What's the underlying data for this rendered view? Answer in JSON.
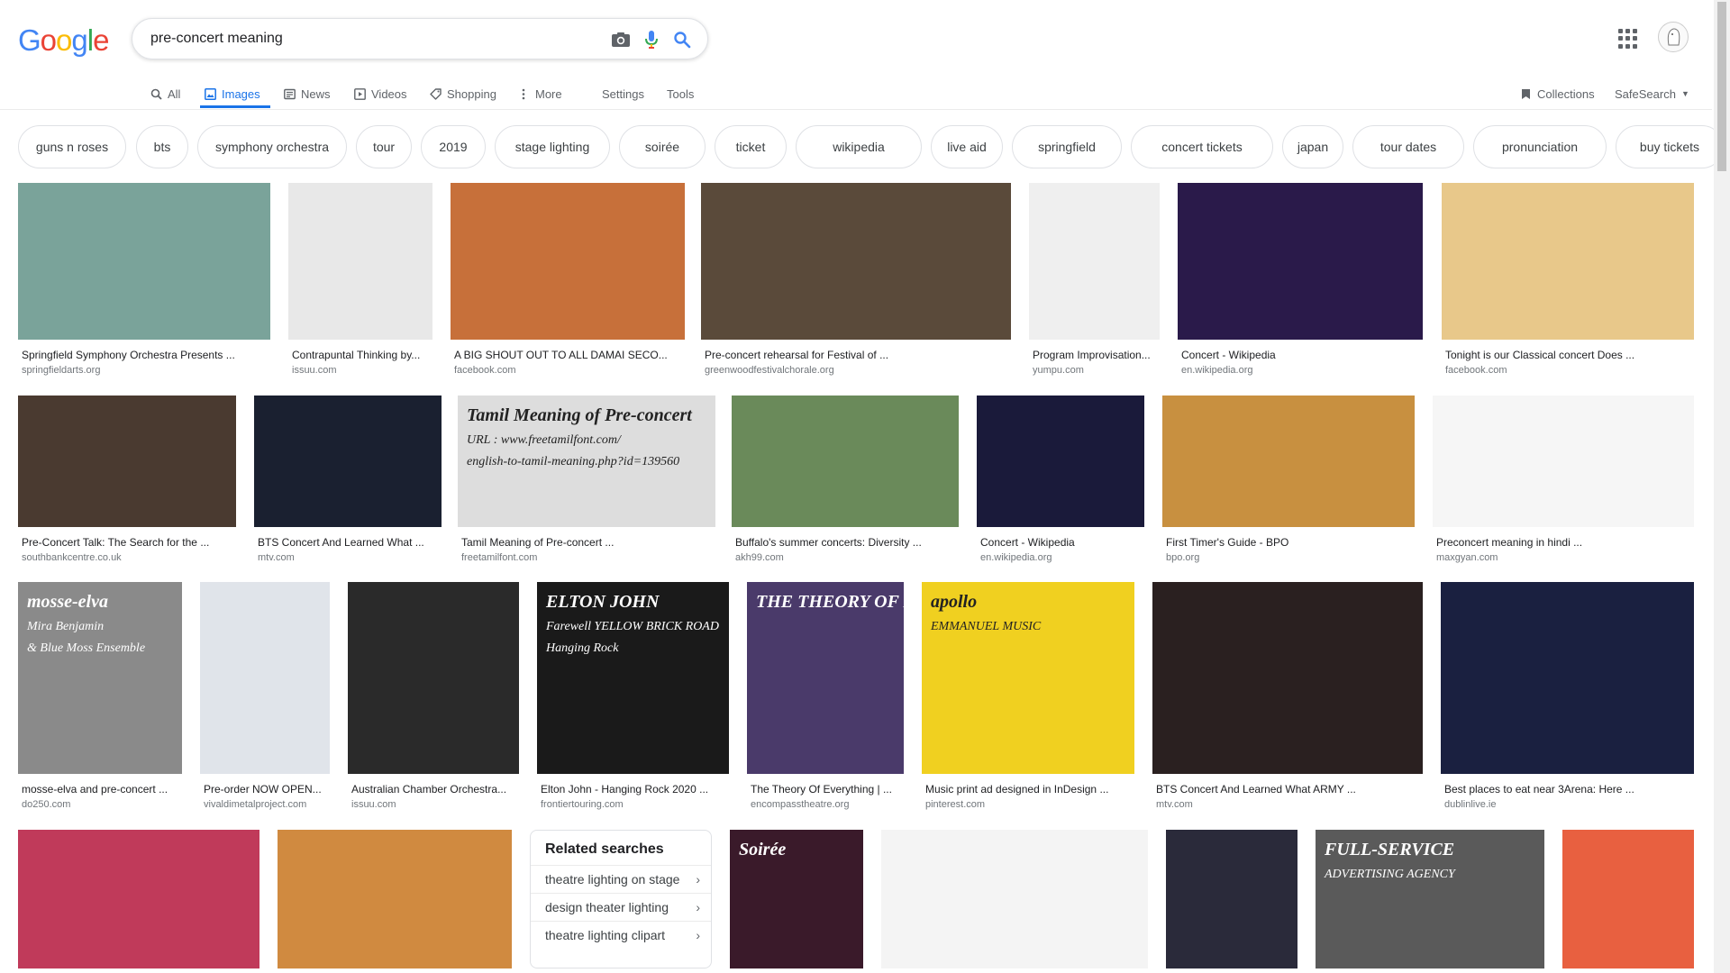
{
  "logo": {
    "letters": [
      "G",
      "o",
      "o",
      "g",
      "l",
      "e"
    ],
    "colors": [
      "#4285F4",
      "#EA4335",
      "#FBBC05",
      "#4285F4",
      "#34A853",
      "#EA4335"
    ]
  },
  "search": {
    "query": "pre-concert meaning"
  },
  "tabs": [
    {
      "label": "All",
      "icon": "search-icon"
    },
    {
      "label": "Images",
      "icon": "image-icon"
    },
    {
      "label": "News",
      "icon": "news-icon"
    },
    {
      "label": "Videos",
      "icon": "video-icon"
    },
    {
      "label": "Shopping",
      "icon": "tag-icon"
    },
    {
      "label": "More",
      "icon": "kebab-icon"
    },
    {
      "label": "Settings"
    },
    {
      "label": "Tools"
    }
  ],
  "right_tools": {
    "collections": "Collections",
    "safesearch": "SafeSearch"
  },
  "chips": [
    "guns n roses",
    "bts",
    "symphony orchestra",
    "tour",
    "2019",
    "stage lighting",
    "soirée",
    "ticket",
    "wikipedia",
    "live aid",
    "springfield",
    "concert tickets",
    "japan",
    "tour dates",
    "pronunciation",
    "buy tickets"
  ],
  "results": [
    {
      "caption": "Springfield Symphony Orchestra Presents ...",
      "source": "springfieldarts.org",
      "color": "#7aa39a"
    },
    {
      "caption": "Contrapuntal Thinking by...",
      "source": "issuu.com",
      "color": "#e8e8e8"
    },
    {
      "caption": "A BIG SHOUT OUT TO ALL DAMAI SECO...",
      "source": "facebook.com",
      "color": "#c7703a"
    },
    {
      "caption": "Pre-concert rehearsal for Festival of ...",
      "source": "greenwoodfestivalchorale.org",
      "color": "#5a4a3a"
    },
    {
      "caption": "Program Improvisation...",
      "source": "yumpu.com",
      "color": "#efefef"
    },
    {
      "caption": "Concert - Wikipedia",
      "source": "en.wikipedia.org",
      "color": "#2a1a4a"
    },
    {
      "caption": "Tonight is our Classical concert Does ...",
      "source": "facebook.com",
      "color": "#e8c88a"
    },
    {
      "caption": "Pre-Concert Talk: The Search for the ...",
      "source": "southbankcentre.co.uk",
      "color": "#4a3a30"
    },
    {
      "caption": "BTS Concert And Learned What ...",
      "source": "mtv.com",
      "color": "#1a2030"
    },
    {
      "caption": "Tamil Meaning of Pre-concert ...",
      "source": "freetamilfont.com",
      "color": "#dddddd",
      "overlay": [
        "Tamil Meaning of Pre-concert",
        "URL : www.freetamilfont.com/",
        "english-to-tamil-meaning.php?id=139560"
      ]
    },
    {
      "caption": "Buffalo's summer concerts: Diversity ...",
      "source": "akh99.com",
      "color": "#6a8a5a"
    },
    {
      "caption": "Concert - Wikipedia",
      "source": "en.wikipedia.org",
      "color": "#1a1a3a"
    },
    {
      "caption": "First Timer's Guide - BPO",
      "source": "bpo.org",
      "color": "#c89040"
    },
    {
      "caption": "Preconcert meaning in hindi ...",
      "source": "maxgyan.com",
      "color": "#f6f6f6"
    },
    {
      "caption": "mosse-elva and pre-concert ...",
      "source": "do250.com",
      "color": "#8a8a8a",
      "overlay": [
        "mosse-elva",
        "Mira Benjamin",
        "& Blue Moss Ensemble"
      ]
    },
    {
      "caption": "Pre-order NOW OPEN...",
      "source": "vivaldimetalproject.com",
      "color": "#e0e4ea"
    },
    {
      "caption": "Australian Chamber Orchestra...",
      "source": "issuu.com",
      "color": "#2a2a2a"
    },
    {
      "caption": "Elton John - Hanging Rock 2020 ...",
      "source": "frontiertouring.com",
      "color": "#1a1a1a",
      "overlay": [
        "ELTON JOHN",
        "Farewell YELLOW BRICK ROAD",
        "Hanging Rock"
      ]
    },
    {
      "caption": "The Theory Of Everything | ...",
      "source": "encompasstheatre.org",
      "color": "#4a3a6a",
      "overlay": [
        "THE THEORY OF EVERYTHING"
      ]
    },
    {
      "caption": "Music print ad designed in InDesign ...",
      "source": "pinterest.com",
      "color": "#f0d020",
      "overlay": [
        "apollo",
        "EMMANUEL MUSIC"
      ]
    },
    {
      "caption": "BTS Concert And Learned What ARMY ...",
      "source": "mtv.com",
      "color": "#2a2020"
    },
    {
      "caption": "Best places to eat near 3Arena: Here ...",
      "source": "dublinlive.ie",
      "color": "#1a2040"
    },
    {
      "color": "#c03a5a"
    },
    {
      "color": "#d08a40"
    },
    {
      "color": "#3a1a2a",
      "overlay": [
        "Soirée"
      ]
    },
    {
      "color": "#f4f4f4"
    },
    {
      "color": "#2a2a3a"
    },
    {
      "color": "#5a5a5a",
      "overlay": [
        "FULL-SERVICE",
        "ADVERTISING AGENCY"
      ]
    },
    {
      "color": "#e86040"
    }
  ],
  "related": {
    "heading": "Related searches",
    "items": [
      "theatre lighting on stage",
      "design theater lighting",
      "theatre lighting clipart"
    ]
  }
}
